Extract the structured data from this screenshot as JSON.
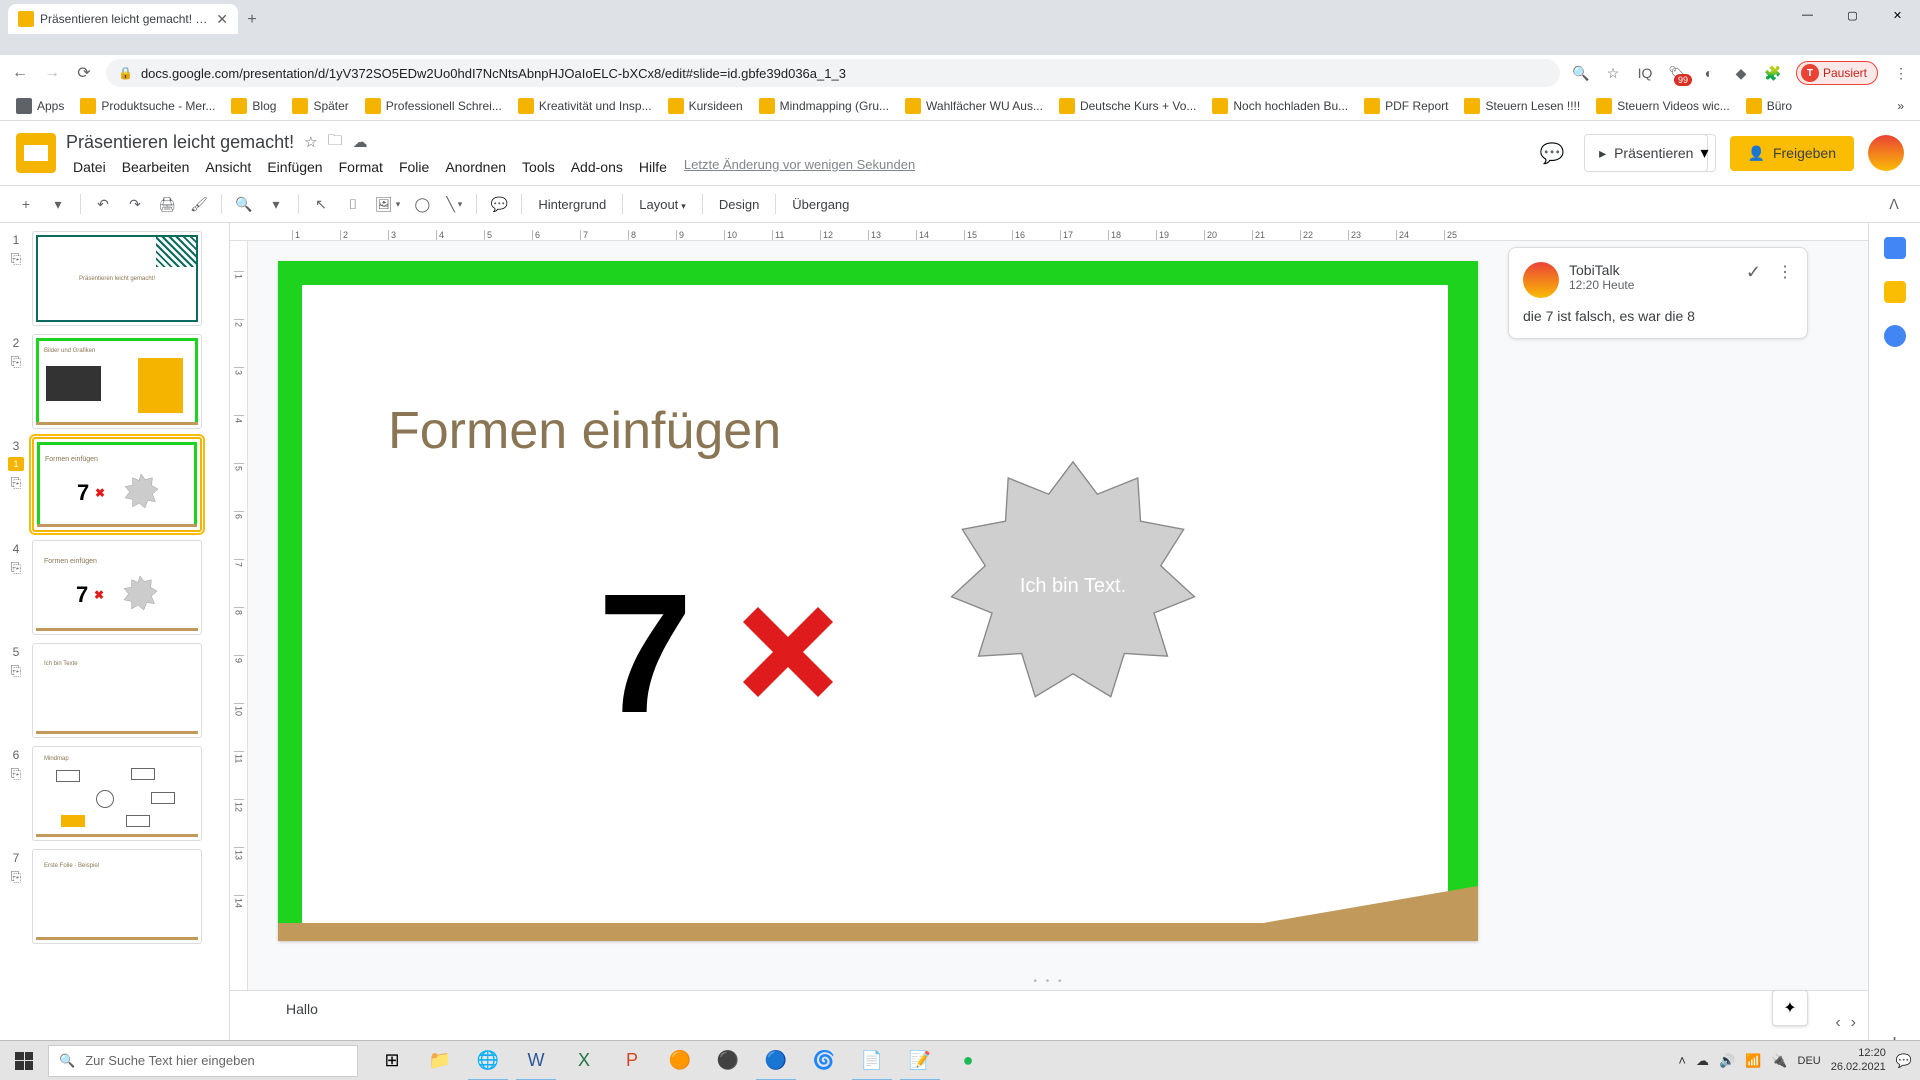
{
  "browser": {
    "tab_title": "Präsentieren leicht gemacht! - G...",
    "url": "docs.google.com/presentation/d/1yV372SO5EDw2Uo0hdI7NcNtsAbnpHJOaIoELC-bXCx8/edit#slide=id.gbfe39d036a_1_3",
    "profile_status": "Pausiert",
    "bookmarks": [
      "Apps",
      "Produktsuche - Mer...",
      "Blog",
      "Später",
      "Professionell Schrei...",
      "Kreativität und Insp...",
      "Kursideen",
      "Mindmapping (Gru...",
      "Wahlfächer WU Aus...",
      "Deutsche Kurs + Vo...",
      "Noch hochladen Bu...",
      "PDF Report",
      "Steuern Lesen !!!!",
      "Steuern Videos wic...",
      "Büro"
    ]
  },
  "doc": {
    "title": "Präsentieren leicht gemacht!",
    "last_edit": "Letzte Änderung vor wenigen Sekunden",
    "menus": [
      "Datei",
      "Bearbeiten",
      "Ansicht",
      "Einfügen",
      "Format",
      "Folie",
      "Anordnen",
      "Tools",
      "Add-ons",
      "Hilfe"
    ],
    "present": "Präsentieren",
    "share": "Freigeben"
  },
  "toolbar": {
    "background": "Hintergrund",
    "layout": "Layout",
    "design": "Design",
    "transition": "Übergang"
  },
  "ruler_h": [
    "1",
    "2",
    "3",
    "4",
    "5",
    "6",
    "7",
    "8",
    "9",
    "10",
    "11",
    "12",
    "13",
    "14",
    "15",
    "16",
    "17",
    "18",
    "19",
    "20",
    "21",
    "22",
    "23",
    "24",
    "25"
  ],
  "ruler_v": [
    "1",
    "2",
    "3",
    "4",
    "5",
    "6",
    "7",
    "8",
    "9",
    "10",
    "11",
    "12",
    "13",
    "14"
  ],
  "slide": {
    "title": "Formen einfügen",
    "big_number": "7",
    "cross": "✖",
    "shape_text": "Ich bin Text."
  },
  "thumbs": [
    {
      "num": "1",
      "title": "Präsentieren leicht gemacht!"
    },
    {
      "num": "2",
      "title": "Bilder und Grafiken"
    },
    {
      "num": "3",
      "title": "Formen einfügen",
      "active": true,
      "badge": "1"
    },
    {
      "num": "4",
      "title": "Formen einfügen"
    },
    {
      "num": "5",
      "title": "Ich bin Texte"
    },
    {
      "num": "6",
      "title": "Mindmap"
    },
    {
      "num": "7",
      "title": "Erste Folie - Beispiel"
    }
  ],
  "comment": {
    "author": "TobiTalk",
    "time": "12:20 Heute",
    "text": "die 7 ist falsch, es war die 8"
  },
  "notes": "Hallo",
  "taskbar": {
    "search_placeholder": "Zur Suche Text hier eingeben",
    "lang": "DEU",
    "time": "12:20",
    "date": "26.02.2021"
  }
}
